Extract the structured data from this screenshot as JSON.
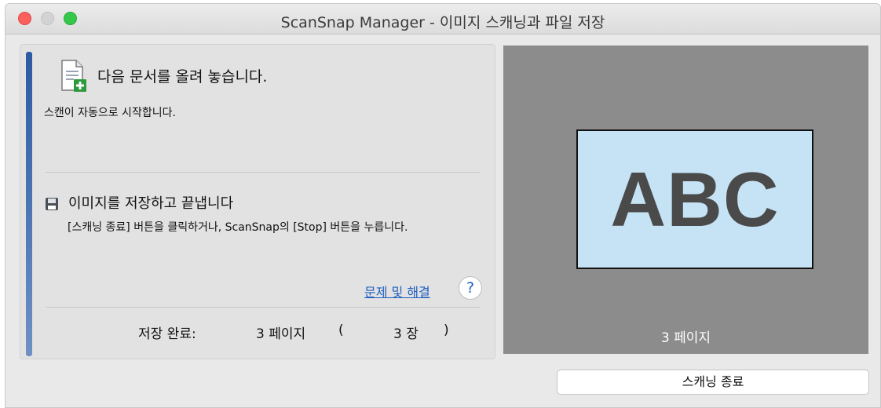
{
  "window": {
    "title": "ScanSnap Manager - 이미지 스캐닝과 파일 저장"
  },
  "step1": {
    "icon": "document-add-icon",
    "title": "다음 문서를 올려 놓습니다.",
    "description": "스캔이 자동으로 시작합니다."
  },
  "step2": {
    "icon": "floppy-disk-icon",
    "title": "이미지를 저장하고 끝냅니다",
    "description": "[스캐닝 종료] 버튼을 클릭하거나, ScanSnap의 [Stop] 버튼을 누릅니다."
  },
  "help": {
    "link_label": "문제 및 해결",
    "button_label": "?"
  },
  "status": {
    "label": "저장 완료:",
    "pages": "3 페이지",
    "paren_open": "(",
    "sheets": "3 장",
    "paren_close": ")"
  },
  "preview": {
    "page_text": "ABC",
    "caption": "3 페이지"
  },
  "buttons": {
    "finish_label": "스캐닝 종료"
  },
  "colors": {
    "accent_bar": "#2b5aa3",
    "link": "#1f5fbf",
    "preview_background": "#8c8c8c",
    "page_fill": "#c6e3f5",
    "close_button": "#fc605c",
    "maximize_button": "#34c84a"
  }
}
